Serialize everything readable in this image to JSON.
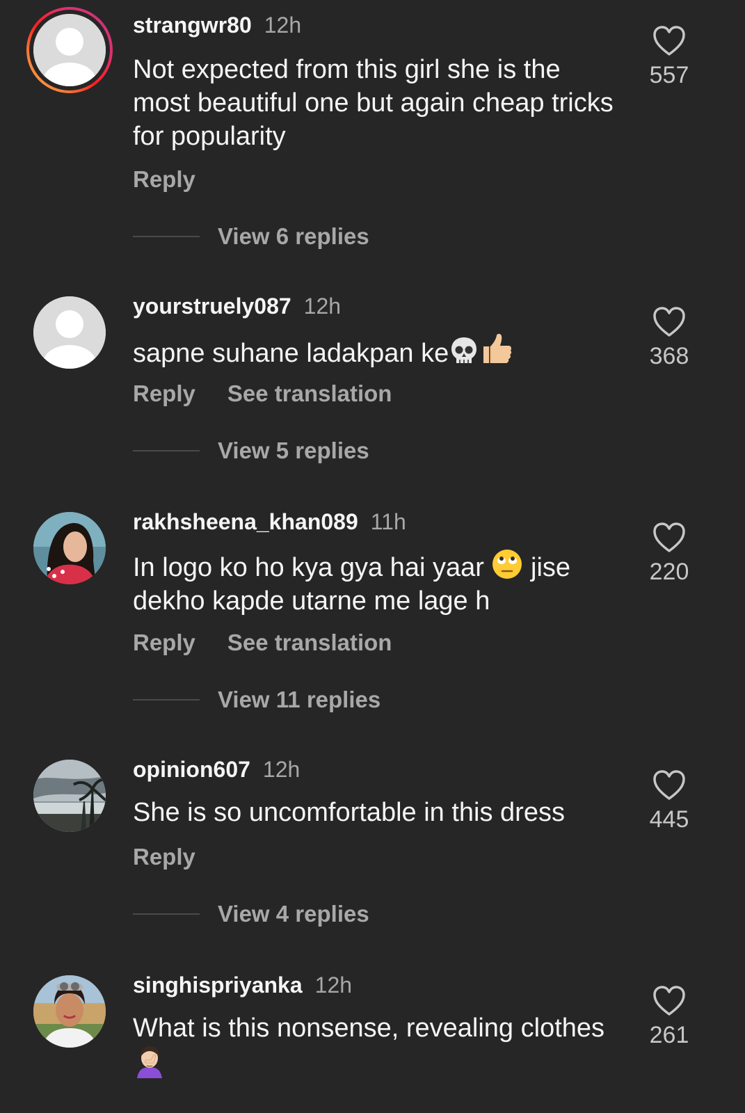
{
  "comments": [
    {
      "username": "strangwr80",
      "time": "12h",
      "text": "Not expected from this girl she is the most beautiful one but again cheap tricks for popularity",
      "reply_label": "Reply",
      "likes": "557",
      "view_replies": "View 6 replies",
      "avatar": "default-avatar-with-story-ring"
    },
    {
      "username": "yourstruely087",
      "time": "12h",
      "text": "sapne suhane ladakpan ke",
      "emojis": [
        "skull-emoji",
        "thumbs-up-emoji"
      ],
      "reply_label": "Reply",
      "translation_label": "See translation",
      "likes": "368",
      "view_replies": "View 5 replies",
      "avatar": "default-avatar"
    },
    {
      "username": "rakhsheena_khan089",
      "time": "11h",
      "text_part1": "In logo ko ho kya gya hai yaar",
      "text_part2": "jise dekho kapde utarne me lage h",
      "emojis": [
        "eye-roll-emoji"
      ],
      "reply_label": "Reply",
      "translation_label": "See translation",
      "likes": "220",
      "view_replies": "View 11 replies",
      "avatar": "photo-avatar-woman"
    },
    {
      "username": "opinion607",
      "time": "12h",
      "text": "She is so uncomfortable in this dress",
      "reply_label": "Reply",
      "likes": "445",
      "view_replies": "View 4 replies",
      "avatar": "photo-avatar-beach"
    },
    {
      "username": "singhispriyanka",
      "time": "12h",
      "text": "What is this nonsense, revealing clothes",
      "emojis": [
        "facepalm-emoji"
      ],
      "likes": "261",
      "avatar": "photo-avatar-woman-sunglasses"
    }
  ],
  "colors": {
    "background": "#262626",
    "primary_text": "#f5f5f5",
    "secondary_text": "#a8a8a8"
  }
}
